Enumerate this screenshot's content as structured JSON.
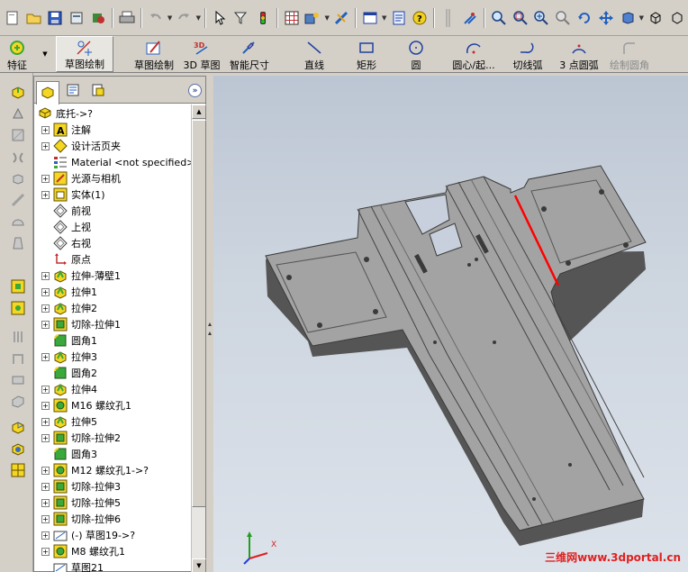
{
  "command_manager": {
    "buttons": [
      {
        "label": "特征",
        "icon": "features-icon"
      },
      {
        "label": "草图绘制",
        "icon": "sketch-icon"
      },
      {
        "label": "草图绘制",
        "icon": "sketch-edit-icon"
      },
      {
        "label": "3D 草图",
        "icon": "3d-sketch-icon"
      },
      {
        "label": "智能尺寸",
        "icon": "smart-dimension-icon"
      },
      {
        "label": "直线",
        "icon": "line-icon"
      },
      {
        "label": "矩形",
        "icon": "rectangle-icon"
      },
      {
        "label": "圆",
        "icon": "circle-icon"
      },
      {
        "label": "圆心/起...",
        "icon": "centerpoint-arc-icon"
      },
      {
        "label": "切线弧",
        "icon": "tangent-arc-icon"
      },
      {
        "label": "3 点圆弧",
        "icon": "three-point-arc-icon"
      },
      {
        "label": "绘制圆角",
        "icon": "sketch-fillet-icon"
      }
    ]
  },
  "feature_tree": {
    "root": "底托->?",
    "items": [
      {
        "label": "注解",
        "icon": "annotations-icon",
        "expandable": true
      },
      {
        "label": "设计活页夹",
        "icon": "design-binder-icon",
        "expandable": true
      },
      {
        "label": "Material <not specified>",
        "icon": "material-icon",
        "expandable": false
      },
      {
        "label": "光源与相机",
        "icon": "lights-cameras-icon",
        "expandable": true
      },
      {
        "label": "实体(1)",
        "icon": "solid-bodies-icon",
        "expandable": true
      },
      {
        "label": "前视",
        "icon": "plane-icon",
        "expandable": false
      },
      {
        "label": "上视",
        "icon": "plane-icon",
        "expandable": false
      },
      {
        "label": "右视",
        "icon": "plane-icon",
        "expandable": false
      },
      {
        "label": "原点",
        "icon": "origin-icon",
        "expandable": false
      },
      {
        "label": "拉伸-薄壁1",
        "icon": "extrude-icon",
        "expandable": true
      },
      {
        "label": "拉伸1",
        "icon": "extrude-icon",
        "expandable": true
      },
      {
        "label": "拉伸2",
        "icon": "extrude-icon",
        "expandable": true
      },
      {
        "label": "切除-拉伸1",
        "icon": "cut-extrude-icon",
        "expandable": true
      },
      {
        "label": "圆角1",
        "icon": "fillet-icon",
        "expandable": false
      },
      {
        "label": "拉伸3",
        "icon": "extrude-icon",
        "expandable": true
      },
      {
        "label": "圆角2",
        "icon": "fillet-icon",
        "expandable": false
      },
      {
        "label": "拉伸4",
        "icon": "extrude-icon",
        "expandable": true
      },
      {
        "label": "M16 螺纹孔1",
        "icon": "hole-wizard-icon",
        "expandable": true
      },
      {
        "label": "拉伸5",
        "icon": "extrude-icon",
        "expandable": true
      },
      {
        "label": "切除-拉伸2",
        "icon": "cut-extrude-icon",
        "expandable": true
      },
      {
        "label": "圆角3",
        "icon": "fillet-icon",
        "expandable": false
      },
      {
        "label": "M12 螺纹孔1->?",
        "icon": "hole-wizard-icon",
        "expandable": true
      },
      {
        "label": "切除-拉伸3",
        "icon": "cut-extrude-icon",
        "expandable": true
      },
      {
        "label": "切除-拉伸5",
        "icon": "cut-extrude-icon",
        "expandable": true
      },
      {
        "label": "切除-拉伸6",
        "icon": "cut-extrude-icon",
        "expandable": true
      },
      {
        "label": "(-) 草图19->?",
        "icon": "sketch-icon",
        "expandable": true
      },
      {
        "label": "M8 螺纹孔1",
        "icon": "hole-wizard-icon",
        "expandable": true
      },
      {
        "label": "草图21",
        "icon": "sketch-icon",
        "expandable": false
      }
    ]
  },
  "viewport": {
    "triad_label": "X",
    "watermark": "三维网www.3dportal.cn"
  },
  "colors": {
    "panel_bg": "#d4d0c8",
    "viewport_top": "#bcc6d3",
    "viewport_bottom": "#dce2ea",
    "part_fill": "#9a9a9a",
    "highlight_edge": "#ff0000",
    "icon_yellow": "#f5d623",
    "icon_green": "#3aa83a"
  }
}
